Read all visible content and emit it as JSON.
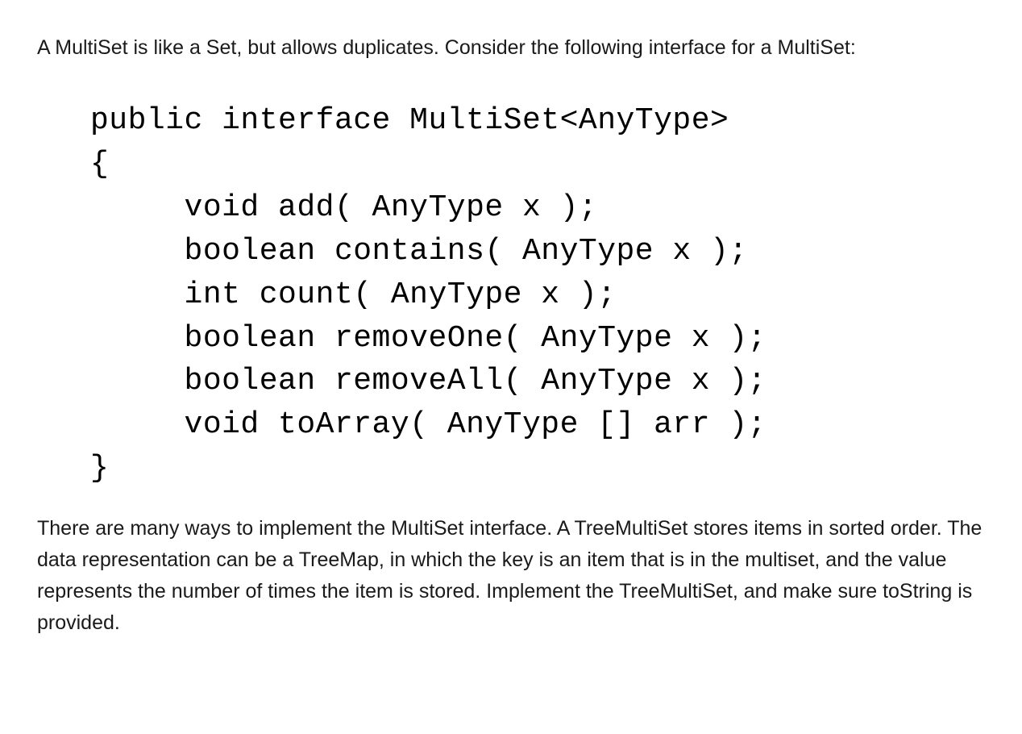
{
  "intro_text": "A MultiSet is like a Set, but allows duplicates. Consider the following interface for a MultiSet:",
  "code": {
    "lines": [
      "public interface MultiSet<AnyType>",
      "{",
      "     void add( AnyType x );",
      "     boolean contains( AnyType x );",
      "     int count( AnyType x );",
      "     boolean removeOne( AnyType x );",
      "     boolean removeAll( AnyType x );",
      "     void toArray( AnyType [] arr );",
      "}"
    ]
  },
  "outro_text": "There are many ways to implement the MultiSet interface. A TreeMultiSet stores items in sorted order. The data representation can be a TreeMap, in which the key is an item that is in the multiset, and the value represents the number of times the item is stored. Implement the TreeMultiSet, and make sure toString is provided."
}
